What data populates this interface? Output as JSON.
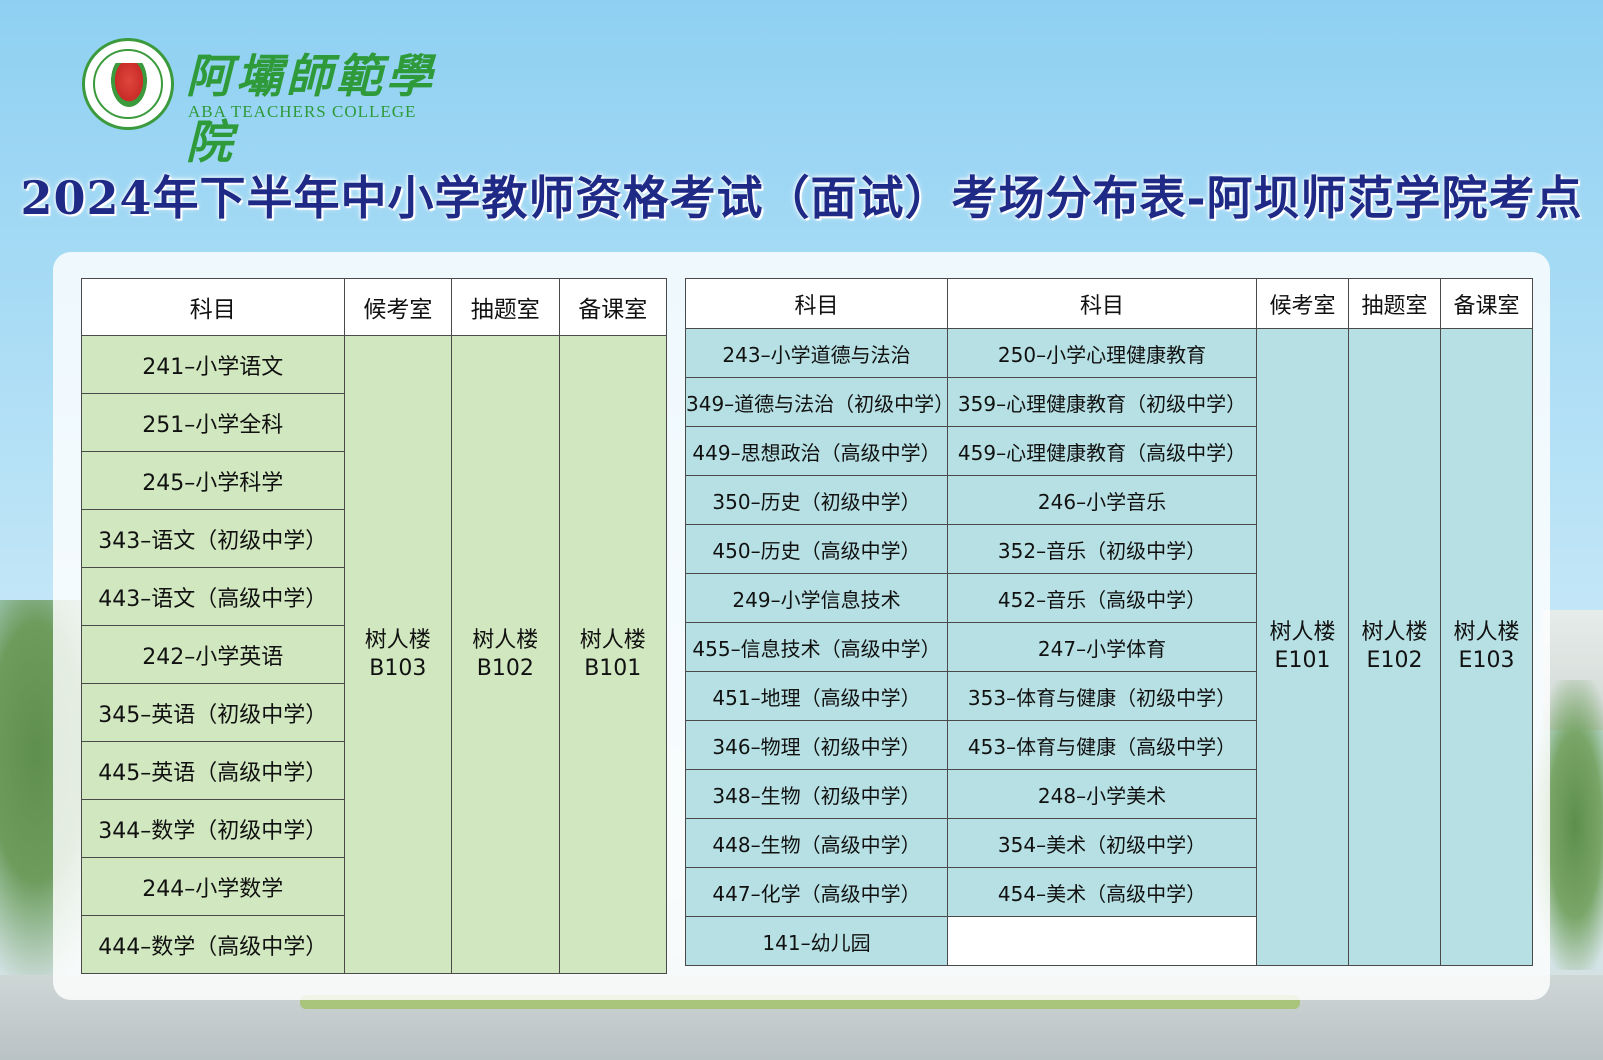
{
  "logo": {
    "name_cn": "阿壩師範學院",
    "name_en": "ABA TEACHERS COLLEGE"
  },
  "title": "2024年下半年中小学教师资格考试（面试）考场分布表-阿坝师范学院考点",
  "left_table": {
    "headers": [
      "科目",
      "候考室",
      "抽题室",
      "备课室"
    ],
    "subjects": [
      "241–小学语文",
      "251–小学全科",
      "245–小学科学",
      "343–语文（初级中学）",
      "443–语文（高级中学）",
      "242–小学英语",
      "345–英语（初级中学）",
      "445–英语（高级中学）",
      "344–数学（初级中学）",
      "244–小学数学",
      "444–数学（高级中学）"
    ],
    "rooms": {
      "waiting": [
        "树人楼",
        "B103"
      ],
      "drawing": [
        "树人楼",
        "B102"
      ],
      "preparation": [
        "树人楼",
        "B101"
      ]
    }
  },
  "right_table": {
    "headers": [
      "科目",
      "科目",
      "候考室",
      "抽题室",
      "备课室"
    ],
    "rows": [
      [
        "243–小学道德与法治",
        "250–小学心理健康教育"
      ],
      [
        "349–道德与法治（初级中学）",
        "359–心理健康教育（初级中学）"
      ],
      [
        "449–思想政治（高级中学）",
        "459–心理健康教育（高级中学）"
      ],
      [
        "350–历史（初级中学）",
        "246–小学音乐"
      ],
      [
        "450–历史（高级中学）",
        "352–音乐（初级中学）"
      ],
      [
        "249–小学信息技术",
        "452–音乐（高级中学）"
      ],
      [
        "455–信息技术（高级中学）",
        "247–小学体育"
      ],
      [
        "451–地理（高级中学）",
        "353–体育与健康（初级中学）"
      ],
      [
        "346–物理（初级中学）",
        "453–体育与健康（高级中学）"
      ],
      [
        "348–生物（初级中学）",
        "248–小学美术"
      ],
      [
        "448–生物（高级中学）",
        "354–美术（初级中学）"
      ],
      [
        "447–化学（高级中学）",
        "454–美术（高级中学）"
      ],
      [
        "141–幼儿园",
        ""
      ]
    ],
    "rooms": {
      "waiting": [
        "树人楼",
        "E101"
      ],
      "drawing": [
        "树人楼",
        "E102"
      ],
      "preparation": [
        "树人楼",
        "E103"
      ]
    }
  },
  "colors": {
    "title": "#1f2a87",
    "logo_green": "#2f9a3a",
    "left_cell": "#d0e7bf",
    "right_cell": "#b6e0e3"
  }
}
